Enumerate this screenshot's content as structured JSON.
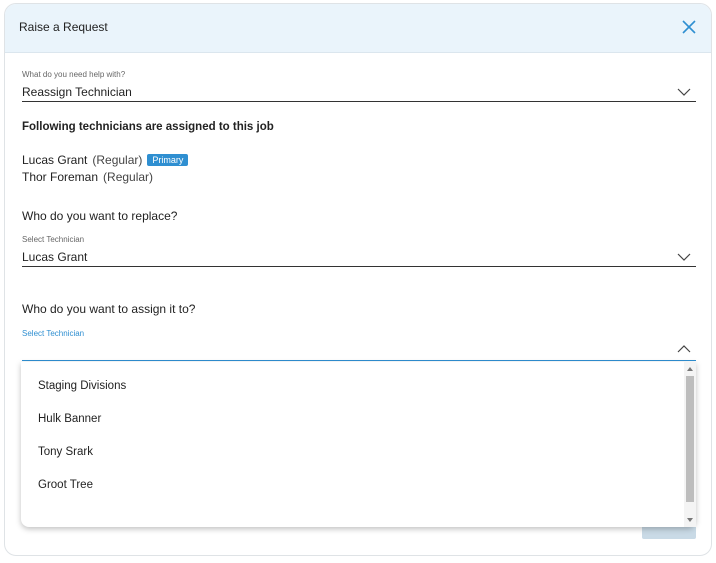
{
  "dialog": {
    "title": "Raise a Request",
    "close_icon": "close-icon"
  },
  "help_field": {
    "label": "What do you need help with?",
    "value": "Reassign Technician"
  },
  "assigned": {
    "heading": "Following technicians are assigned to this job",
    "technicians": [
      {
        "name": "Lucas Grant",
        "role": "(Regular)",
        "badge": "Primary"
      },
      {
        "name": "Thor Foreman",
        "role": "(Regular)"
      }
    ]
  },
  "replace": {
    "question": "Who do you want to replace?",
    "label": "Select Technician",
    "value": "Lucas Grant"
  },
  "assign": {
    "question": "Who do you want to assign it to?",
    "label": "Select Technician",
    "value": "",
    "options": [
      "Staging Divisions",
      "Hulk Banner",
      "Tony Srark",
      "Groot Tree"
    ]
  },
  "colors": {
    "accent": "#2f8fd1",
    "header_bg": "#eaf4fb"
  }
}
